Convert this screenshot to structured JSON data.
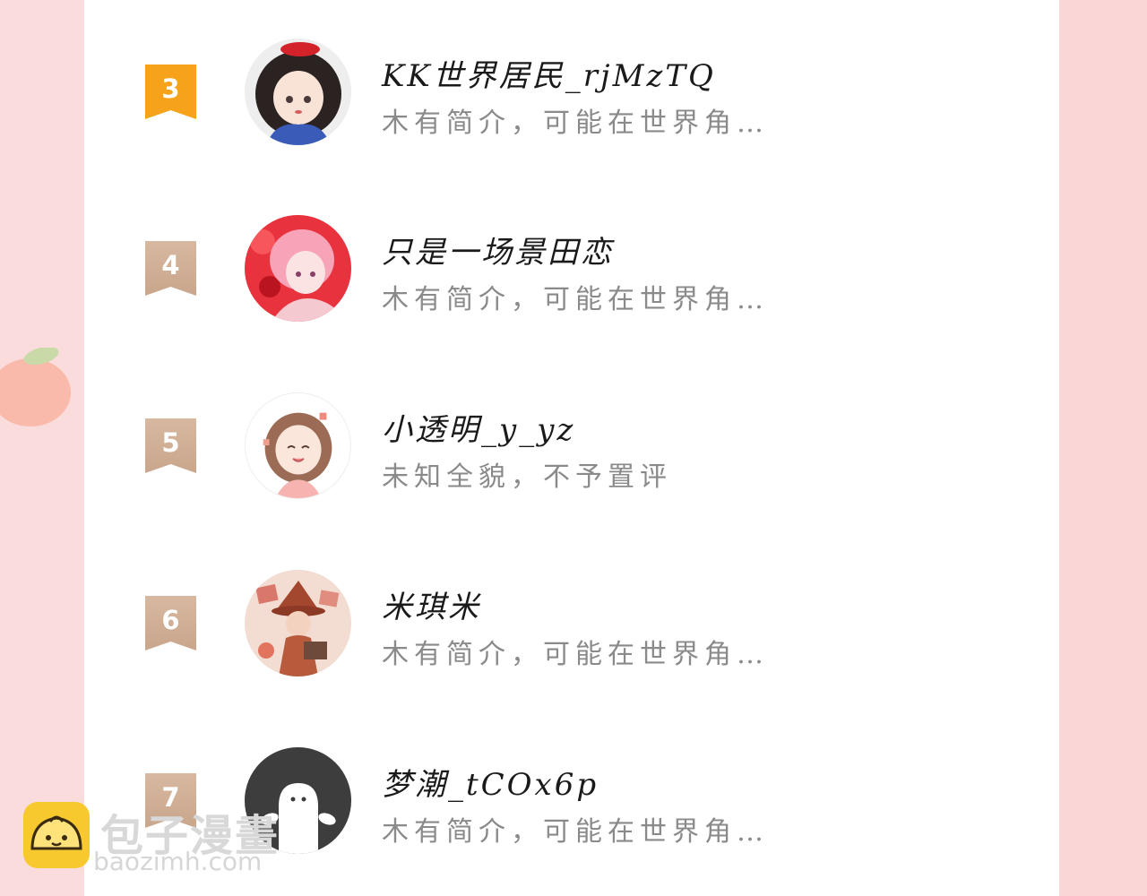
{
  "ranking": {
    "items": [
      {
        "rank": "3",
        "name": "KK世界居民_rjMzTQ",
        "intro": "木有简介，可能在世界角…",
        "badge_color": "#f7a21b",
        "avatar_icon": "snow-white-avatar"
      },
      {
        "rank": "4",
        "name": "只是一场景田恋",
        "intro": "木有简介，可能在世界角…",
        "badge_color": "#cfae95",
        "avatar_icon": "pink-hair-girl-avatar"
      },
      {
        "rank": "5",
        "name": "小透明_y_yz",
        "intro": "未知全貌，不予置评",
        "badge_color": "#cfae95",
        "avatar_icon": "smiling-girl-avatar"
      },
      {
        "rank": "6",
        "name": "米琪米",
        "intro": "木有简介，可能在世界角…",
        "badge_color": "#cfae95",
        "avatar_icon": "witch-avatar"
      },
      {
        "rank": "7",
        "name": "梦潮_tCOx6p",
        "intro": "木有简介，可能在世界角…",
        "badge_color": "#cfae95",
        "avatar_icon": "default-ghost-avatar"
      }
    ]
  },
  "watermark": {
    "title": "包子漫畫",
    "site": "baozimh.com",
    "logo_icon": "bun-logo-icon"
  },
  "decoration": {
    "left_icon": "peach-icon"
  }
}
